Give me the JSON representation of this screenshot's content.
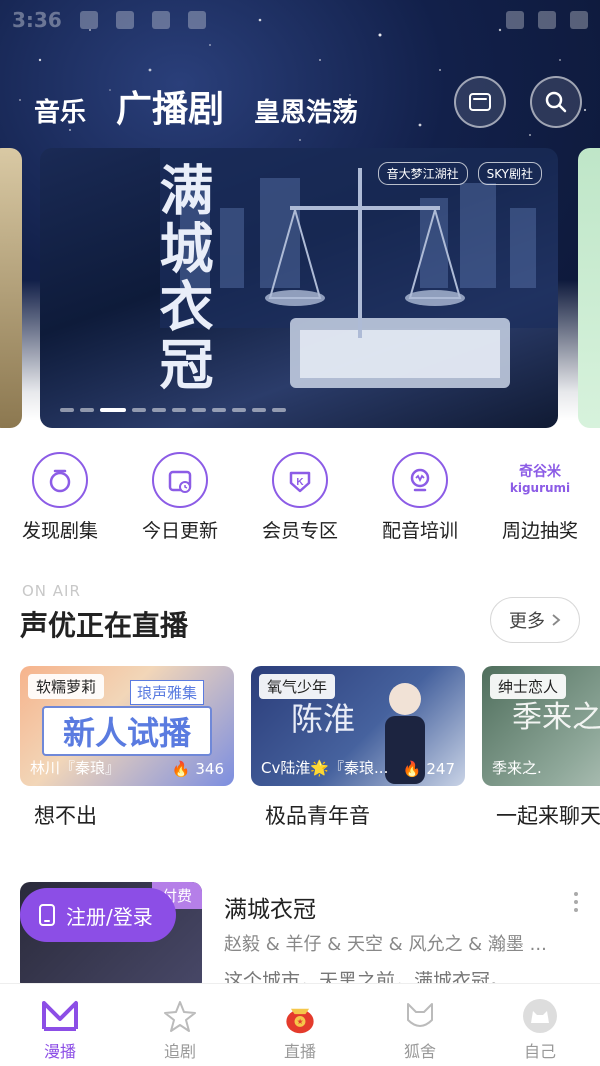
{
  "status_bar": {
    "time": "3:36"
  },
  "header": {
    "tabs": [
      {
        "label": "音乐",
        "active": false
      },
      {
        "label": "广播剧",
        "active": true
      },
      {
        "label": "皇恩浩荡",
        "active": false
      }
    ],
    "icons": [
      "mail-icon",
      "search-icon"
    ]
  },
  "banner": {
    "title": "满城衣冠",
    "logos": [
      "音大梦江湖社",
      "SKY剧社"
    ],
    "page_count": 12,
    "active_index": 2
  },
  "quick_nav": [
    {
      "label": "发现剧集",
      "icon": "discover-icon"
    },
    {
      "label": "今日更新",
      "icon": "calendar-icon"
    },
    {
      "label": "会员专区",
      "icon": "vip-icon"
    },
    {
      "label": "配音培训",
      "icon": "mic-training-icon"
    },
    {
      "label": "周边抽奖",
      "icon_text_top": "奇谷米",
      "icon_text_bottom": "kigurumi"
    }
  ],
  "live": {
    "kicker": "ON AIR",
    "title": "声优正在直播",
    "more": "更多",
    "cards": [
      {
        "tag": "软糯萝莉",
        "image_text": "新人试播",
        "image_subtext": "琅声雅集",
        "host": "林川『秦琅』",
        "count": "346",
        "caption": "想不出"
      },
      {
        "tag": "氧气少年",
        "image_text": "陈淮",
        "host": "Cv陆淮🌟『秦琅...",
        "count": "247",
        "caption": "极品青年音"
      },
      {
        "tag": "绅士恋人",
        "image_text": "季来之",
        "host": "季来之.",
        "count": "",
        "caption": "一起来聊天"
      }
    ]
  },
  "drama": {
    "badge": "付费",
    "title": "满城衣冠",
    "cast": "赵毅 & 羊仔 & 天空 & 风允之 & 瀚墨 ...",
    "desc": "这个城市，天黑之前，满城衣冠。",
    "login_label": "注册/登录"
  },
  "bottom_nav": [
    {
      "label": "漫播",
      "active": true
    },
    {
      "label": "追剧",
      "active": false
    },
    {
      "label": "直播",
      "active": false
    },
    {
      "label": "狐舍",
      "active": false
    },
    {
      "label": "自己",
      "active": false
    }
  ],
  "colors": {
    "accent": "#8c4ee6",
    "header_bg": "#12204a"
  }
}
